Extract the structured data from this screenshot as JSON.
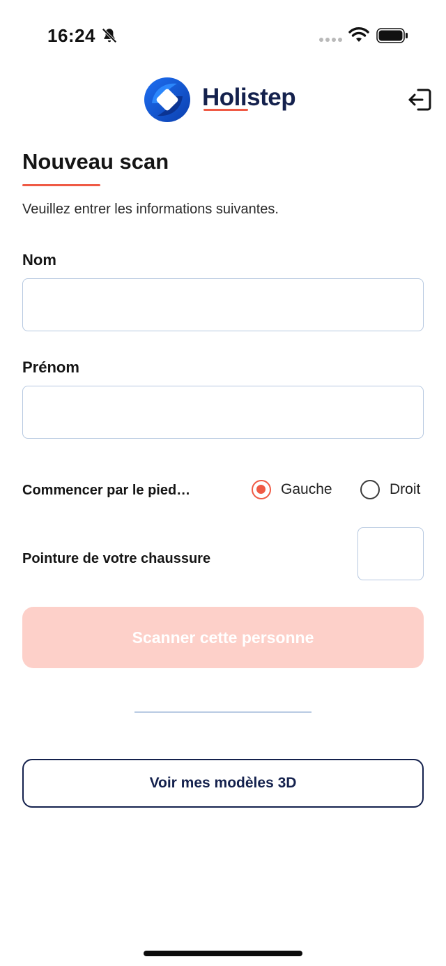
{
  "status_bar": {
    "time": "16:24",
    "icons": [
      "bell-off-icon",
      "signal-dots-icon",
      "wifi-icon",
      "battery-icon"
    ]
  },
  "header": {
    "brand": "Holistep",
    "logout_icon": "logout-icon"
  },
  "page": {
    "title": "Nouveau scan",
    "subtitle": "Veuillez entrer les informations suivantes."
  },
  "form": {
    "last_name": {
      "label": "Nom",
      "value": "",
      "placeholder": ""
    },
    "first_name": {
      "label": "Prénom",
      "value": "",
      "placeholder": ""
    },
    "foot": {
      "label": "Commencer par le pied…",
      "options": [
        {
          "label": "Gauche",
          "selected": true
        },
        {
          "label": "Droit",
          "selected": false
        }
      ]
    },
    "shoe_size": {
      "label": "Pointure de votre chaussure",
      "value": ""
    }
  },
  "actions": {
    "scan_label": "Scanner cette personne",
    "models_label": "Voir mes modèles 3D"
  },
  "colors": {
    "accent": "#ef5a45",
    "navy": "#14214d",
    "disabled_button": "#fdd0c9",
    "field_border": "#b6c8e0"
  }
}
